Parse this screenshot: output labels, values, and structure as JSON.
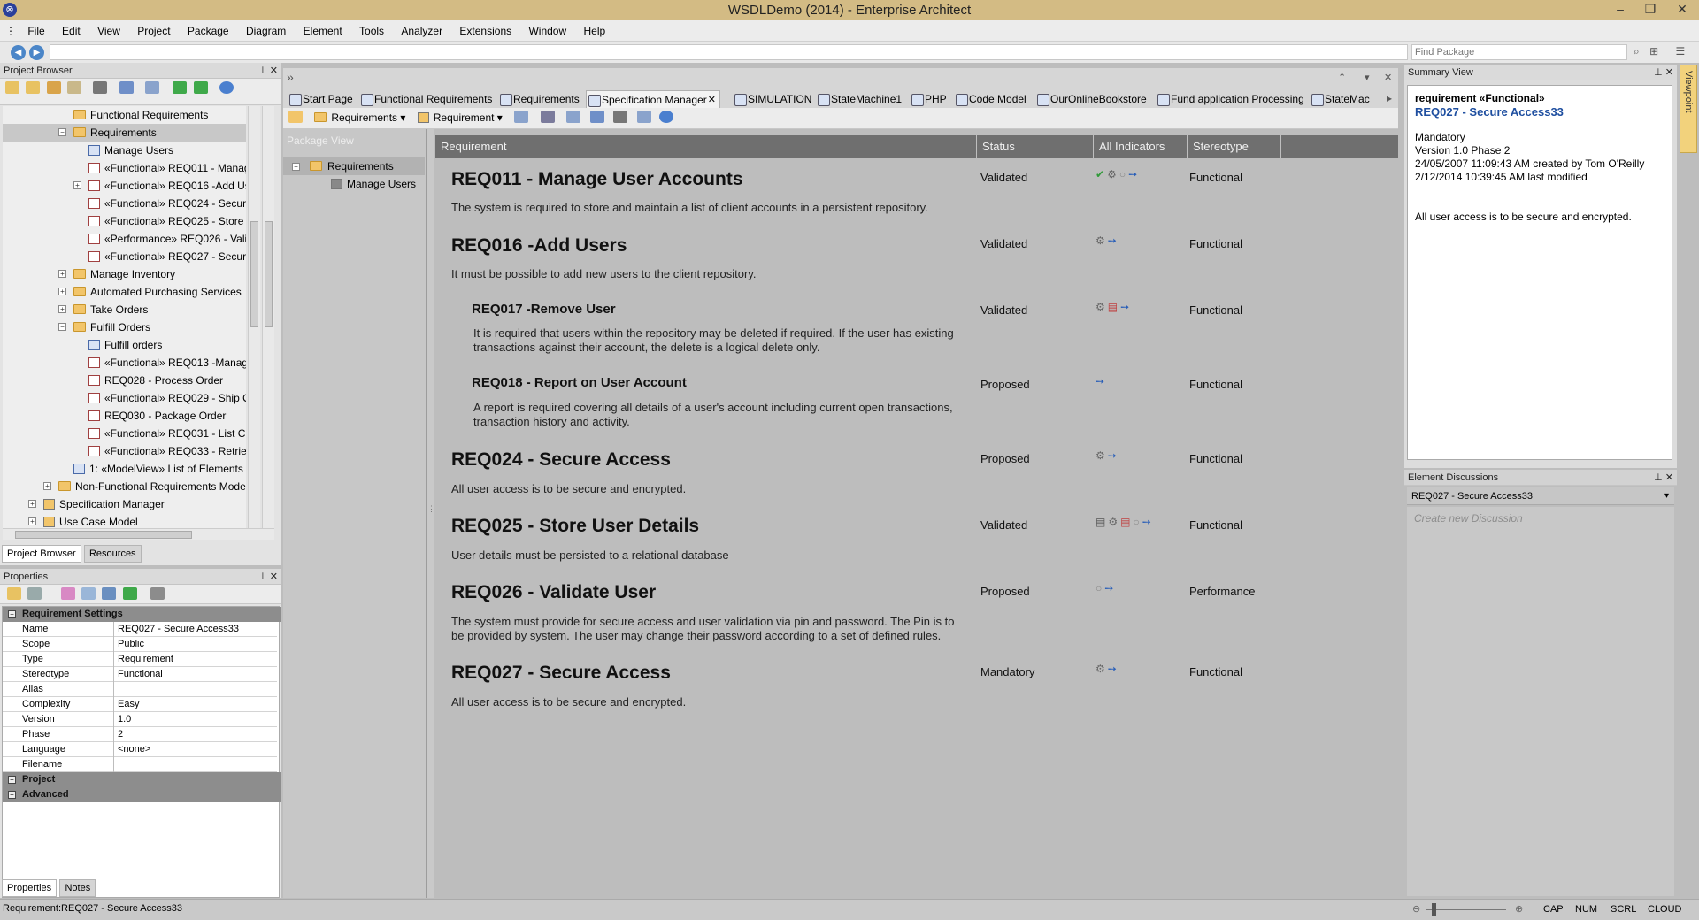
{
  "window": {
    "title": "WSDLDemo (2014) - Enterprise Architect"
  },
  "menu": [
    "File",
    "Edit",
    "View",
    "Project",
    "Package",
    "Diagram",
    "Element",
    "Tools",
    "Analyzer",
    "Extensions",
    "Window",
    "Help"
  ],
  "nav": {
    "find_placeholder": "Find Package"
  },
  "project_browser": {
    "title": "Project Browser",
    "items": [
      {
        "label": "Functional Requirements"
      },
      {
        "label": "Requirements"
      },
      {
        "label": "Manage Users"
      },
      {
        "label": "«Functional» REQ011 - Manag"
      },
      {
        "label": "«Functional» REQ016 -Add Us"
      },
      {
        "label": "«Functional» REQ024 - Secure"
      },
      {
        "label": "«Functional» REQ025 - Store U"
      },
      {
        "label": "«Performance» REQ026 - Valic"
      },
      {
        "label": "«Functional» REQ027 - Secure"
      },
      {
        "label": "Manage Inventory"
      },
      {
        "label": "Automated Purchasing Services"
      },
      {
        "label": "Take Orders"
      },
      {
        "label": "Fulfill Orders"
      },
      {
        "label": "Fulfill orders"
      },
      {
        "label": "«Functional» REQ013 -Manag"
      },
      {
        "label": "REQ028 - Process Order"
      },
      {
        "label": "«Functional» REQ029 - Ship O"
      },
      {
        "label": "REQ030 - Package Order"
      },
      {
        "label": "«Functional» REQ031 - List Cu"
      },
      {
        "label": "«Functional» REQ033 - Retriev"
      },
      {
        "label": "1: «ModelView» List of Elements i"
      },
      {
        "label": "Non-Functional Requirements Mode"
      },
      {
        "label": "Specification Manager"
      },
      {
        "label": "Use Case Model"
      }
    ],
    "tabs": [
      "Project Browser",
      "Resources"
    ]
  },
  "properties": {
    "title": "Properties",
    "section": "Requirement Settings",
    "rows": [
      {
        "key": "Name",
        "value": "REQ027 - Secure Access33"
      },
      {
        "key": "Scope",
        "value": "Public"
      },
      {
        "key": "Type",
        "value": "Requirement"
      },
      {
        "key": "Stereotype",
        "value": "Functional"
      },
      {
        "key": "Alias",
        "value": ""
      },
      {
        "key": "Complexity",
        "value": "Easy"
      },
      {
        "key": "Version",
        "value": "1.0"
      },
      {
        "key": "Phase",
        "value": "2"
      },
      {
        "key": "Language",
        "value": "<none>"
      },
      {
        "key": "Filename",
        "value": ""
      }
    ],
    "sections_collapsed": [
      "Project",
      "Advanced"
    ],
    "tabs": [
      "Properties",
      "Notes"
    ]
  },
  "doc_tabs": [
    "Start Page",
    "Functional Requirements",
    "Requirements",
    "Specification Manager",
    "SIMULATION",
    "StateMachine1",
    "PHP",
    "Code Model",
    "OurOnlineBookstore",
    "Fund application Processing",
    "StateMac"
  ],
  "spec_toolbar": {
    "package": "Requirements",
    "type": "Requirement"
  },
  "package_view": {
    "title": "Package View",
    "root": "Requirements",
    "child": "Manage Users"
  },
  "spec_table": {
    "columns": [
      "Requirement",
      "Status",
      "All Indicators",
      "Stereotype"
    ],
    "rows": [
      {
        "title": "REQ011 - Manage User Accounts",
        "desc": "The system is required to store and maintain a list of client accounts in a persistent repository.",
        "status": "Validated",
        "stereotype": "Functional"
      },
      {
        "title": "REQ016 -Add Users",
        "desc": "It must be possible to add new users to the client repository.",
        "status": "Validated",
        "stereotype": "Functional"
      },
      {
        "title": "REQ017 -Remove User",
        "desc": "It is required that users within the repository may be deleted if required. If the user has existing transactions against their account, the delete is a logical delete only.",
        "status": "Validated",
        "stereotype": "Functional"
      },
      {
        "title": "REQ018 - Report on User Account",
        "desc": "A report is required covering all details of a user's account including current open transactions, transaction history and activity.",
        "status": "Proposed",
        "stereotype": "Functional"
      },
      {
        "title": "REQ024 - Secure Access",
        "desc": "All user access is to be secure and encrypted.",
        "status": "Proposed",
        "stereotype": "Functional"
      },
      {
        "title": "REQ025 - Store User Details",
        "desc": "User details must be persisted to a relational database",
        "status": "Validated",
        "stereotype": "Functional"
      },
      {
        "title": "REQ026 - Validate User",
        "desc": "The system must provide for secure access and user validation via pin and password. The Pin is to be provided by system. The user may change their password according to a set of defined rules.",
        "status": "Proposed",
        "stereotype": "Performance"
      },
      {
        "title": "REQ027 - Secure Access",
        "desc": "All user access is to be secure and encrypted.",
        "status": "Mandatory",
        "stereotype": "Functional"
      }
    ]
  },
  "summary": {
    "title": "Summary View",
    "stereo": "requirement  «Functional»",
    "name": "REQ027 - Secure Access33",
    "lines": [
      "Mandatory",
      "Version 1.0  Phase 2",
      "24/05/2007 11:09:43 AM created by Tom O'Reilly",
      "2/12/2014 10:39:45 AM last modified"
    ],
    "notes": "All user access is to be secure and encrypted.",
    "side_tab": "Viewpoint"
  },
  "discussions": {
    "title": "Element Discussions",
    "element": "REQ027 - Secure Access33",
    "placeholder": "Create new Discussion"
  },
  "status": {
    "left": "Requirement:REQ027 - Secure Access33",
    "indicators": [
      "CAP",
      "NUM",
      "SCRL",
      "CLOUD"
    ]
  },
  "colors": {
    "titlebar": "#d3bb84",
    "header": "#6f6f6f",
    "content": "#bdbdbd",
    "link": "#1f4fa0"
  }
}
